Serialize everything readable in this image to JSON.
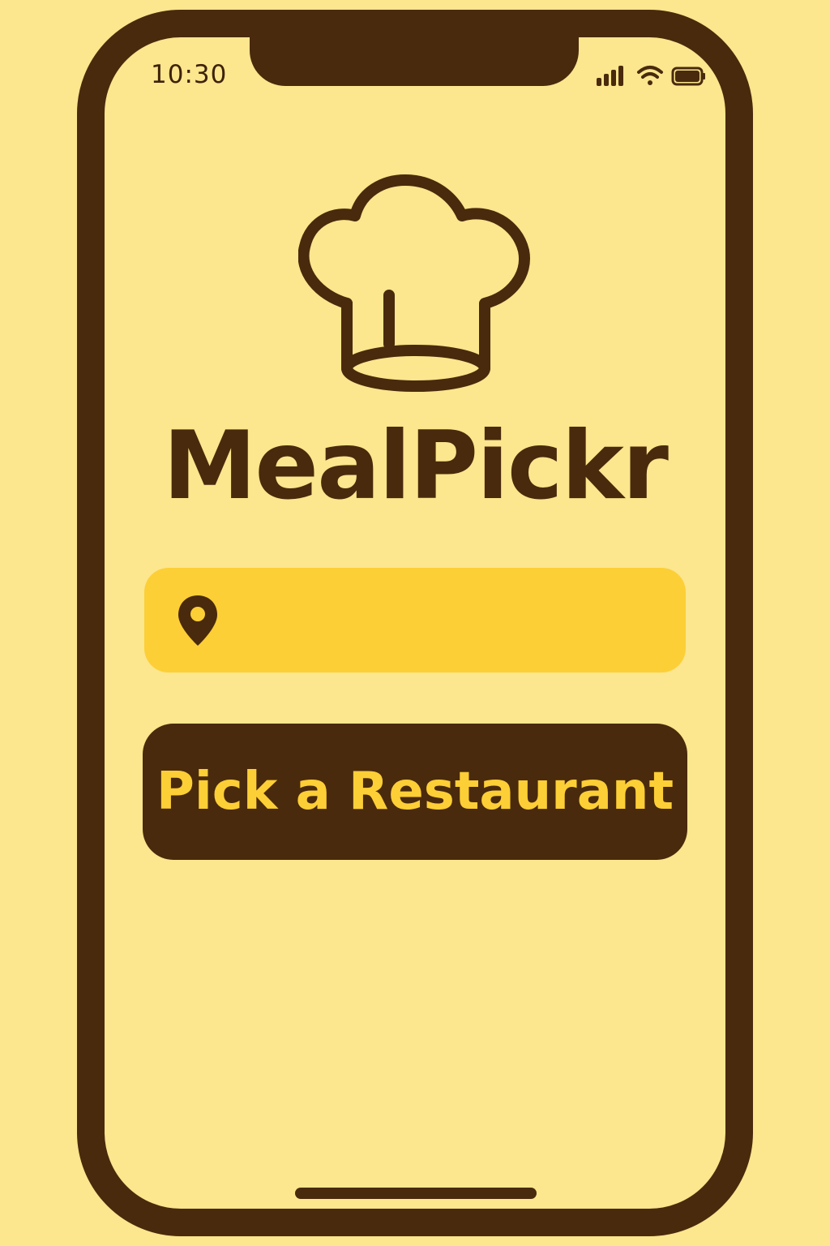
{
  "status_bar": {
    "time": "10:30",
    "signal_icon": "cellular-signal-icon",
    "wifi_icon": "wifi-icon",
    "battery_icon": "battery-icon"
  },
  "app": {
    "logo_icon": "chef-hat-icon",
    "title": "MealPickr"
  },
  "location_input": {
    "icon": "location-pin-icon",
    "value": "",
    "placeholder": ""
  },
  "primary_button": {
    "label": "Pick a Restaurant"
  },
  "colors": {
    "background": "#fce68e",
    "brown": "#4a2a0c",
    "yellow_accent": "#fdcf36"
  }
}
